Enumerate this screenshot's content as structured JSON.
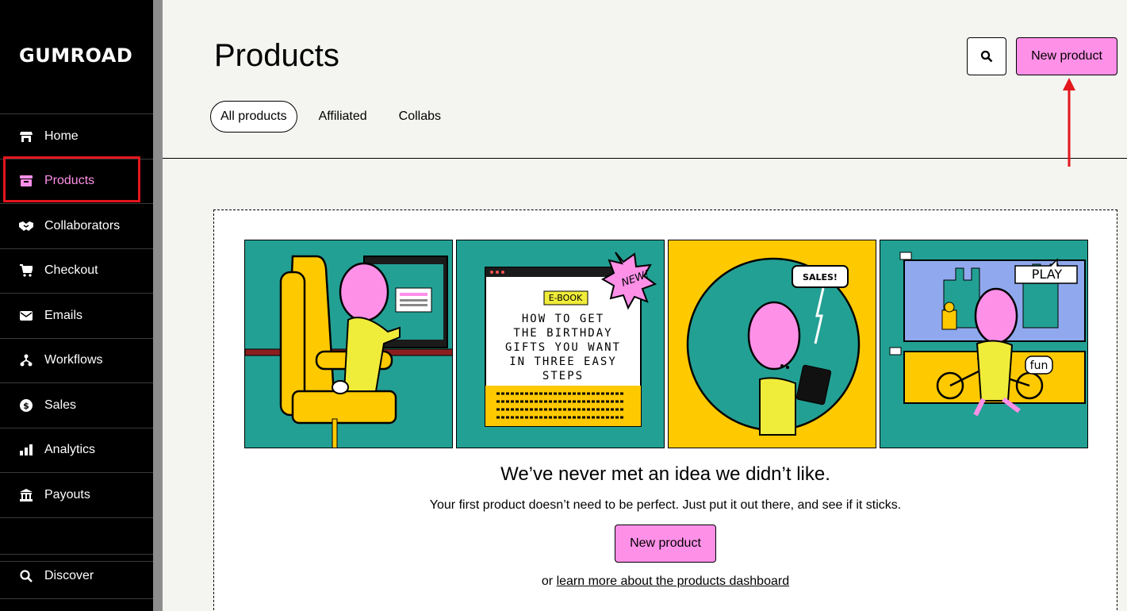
{
  "app": {
    "logo_text": "GUMROAD"
  },
  "sidebar": {
    "items": [
      {
        "label": "Home",
        "icon": "store-icon"
      },
      {
        "label": "Products",
        "icon": "archive-icon",
        "active": true
      },
      {
        "label": "Collaborators",
        "icon": "handshake-icon"
      },
      {
        "label": "Checkout",
        "icon": "cart-icon"
      },
      {
        "label": "Emails",
        "icon": "envelope-icon"
      },
      {
        "label": "Workflows",
        "icon": "workflow-icon"
      },
      {
        "label": "Sales",
        "icon": "dollar-circle-icon"
      },
      {
        "label": "Analytics",
        "icon": "bar-chart-icon"
      },
      {
        "label": "Payouts",
        "icon": "bank-icon"
      }
    ],
    "bottom_items": [
      {
        "label": "Discover",
        "icon": "search-icon"
      }
    ]
  },
  "header": {
    "title": "Products",
    "new_product_label": "New product",
    "tabs": [
      {
        "label": "All products",
        "active": true
      },
      {
        "label": "Affiliated",
        "active": false
      },
      {
        "label": "Collabs",
        "active": false
      }
    ]
  },
  "empty_state": {
    "illustration": {
      "ebook_tag": "E-BOOK",
      "ebook_title_lines": [
        "HOW TO GET",
        "THE BIRTHDAY",
        "GIFTS YOU WANT",
        "IN THREE EASY",
        "STEPS"
      ],
      "new_burst": "NEW!",
      "sales_bubble": "SALES!",
      "play_sign": "PLAY",
      "fun_tag": "fun"
    },
    "title": "We’ve never met an idea we didn’t like.",
    "subtitle": "Your first product doesn’t need to be perfect. Just put it out there, and see if it sticks.",
    "button_label": "New product",
    "or_text": "or ",
    "link_text": "learn more about the products dashboard"
  },
  "colors": {
    "accent_pink": "#ff90e8",
    "teal": "#23a094",
    "yellow": "#ffc900",
    "annotation_red": "#e3161c"
  }
}
